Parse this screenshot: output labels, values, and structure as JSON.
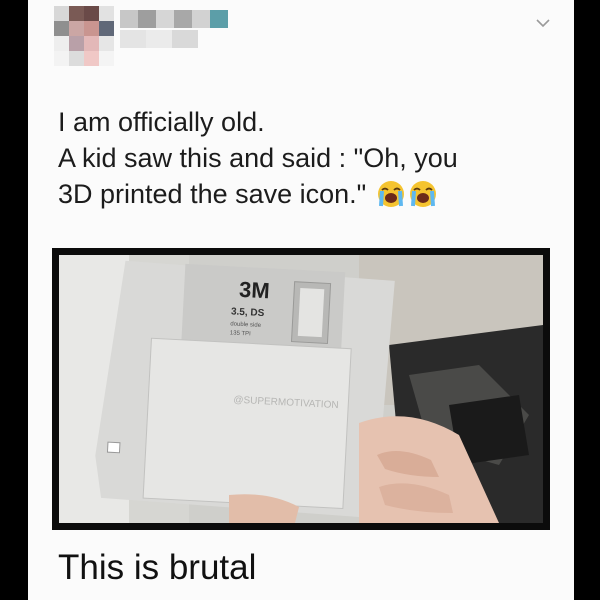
{
  "post": {
    "text_lines": [
      "I am officially old.",
      "A kid saw this and said : \"Oh, you",
      "3D printed the save icon.\""
    ],
    "emojis": [
      "loudly-crying-face-emoji",
      "loudly-crying-face-emoji"
    ],
    "caption": "This is brutal"
  },
  "photo": {
    "floppy_brand": "3M",
    "floppy_label_lines": [
      "3.5, DS",
      "double side",
      "135 TPI"
    ],
    "watermark": "@SUPERMOTIVATION"
  },
  "header": {
    "menu_icon": "chevron-down-icon"
  },
  "colors": {
    "text": "#1c1c1c",
    "background": "#fbfbfb",
    "frame": "#000000"
  }
}
